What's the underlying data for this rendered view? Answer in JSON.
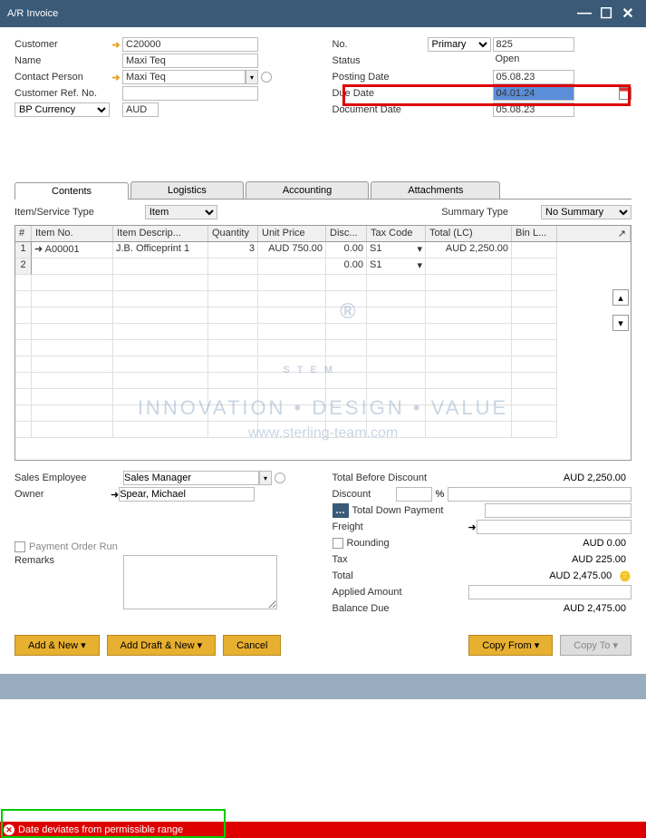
{
  "window": {
    "title": "A/R Invoice"
  },
  "header": {
    "left": {
      "customer_lbl": "Customer",
      "customer": "C20000",
      "name_lbl": "Name",
      "name": "Maxi Teq",
      "contact_lbl": "Contact Person",
      "contact": "Maxi Teq",
      "custref_lbl": "Customer Ref. No.",
      "custref": "",
      "bpcur_lbl": "BP Currency",
      "bpcur": "AUD"
    },
    "right": {
      "no_lbl": "No.",
      "no_type": "Primary",
      "no_val": "825",
      "status_lbl": "Status",
      "status": "Open",
      "posting_lbl": "Posting Date",
      "posting": "05.08.23",
      "due_lbl": "Due Date",
      "due": "04.01.24",
      "doc_lbl": "Document Date",
      "doc": "05.08.23"
    }
  },
  "tabs": [
    "Contents",
    "Logistics",
    "Accounting",
    "Attachments"
  ],
  "sub": {
    "itemservice_lbl": "Item/Service Type",
    "itemservice": "Item",
    "summary_lbl": "Summary Type",
    "summary": "No Summary"
  },
  "grid": {
    "columns": [
      "#",
      "Item No.",
      "Item Descrip...",
      "Quantity",
      "Unit Price",
      "Disc...",
      "Tax Code",
      "Total (LC)",
      "Bin L..."
    ],
    "rows": [
      {
        "n": "1",
        "item": "A00001",
        "desc": "J.B. Officeprint 1",
        "qty": "3",
        "price": "AUD 750.00",
        "disc": "0.00",
        "tax": "S1",
        "total": "AUD 2,250.00",
        "bin": ""
      },
      {
        "n": "2",
        "item": "",
        "desc": "",
        "qty": "",
        "price": "",
        "disc": "0.00",
        "tax": "S1",
        "total": "",
        "bin": ""
      }
    ]
  },
  "watermark": {
    "big": "STEM",
    "reg": "®",
    "tag": "INNOVATION  •  DESIGN  •  VALUE",
    "url": "www.sterling-team.com"
  },
  "bottom_left": {
    "sales_lbl": "Sales Employee",
    "sales": "Sales Manager",
    "owner_lbl": "Owner",
    "owner": "Spear, Michael",
    "payorder_lbl": "Payment Order Run",
    "remarks_lbl": "Remarks"
  },
  "bottom_right": {
    "tbd_lbl": "Total Before Discount",
    "tbd": "AUD 2,250.00",
    "disc_lbl": "Discount",
    "disc_pct": "",
    "pct": "%",
    "tdp_lbl": "Total Down Payment",
    "freight_lbl": "Freight",
    "round_lbl": "Rounding",
    "round": "AUD 0.00",
    "tax_lbl": "Tax",
    "tax": "AUD 225.00",
    "total_lbl": "Total",
    "total": "AUD 2,475.00",
    "applied_lbl": "Applied Amount",
    "balance_lbl": "Balance Due",
    "balance": "AUD 2,475.00"
  },
  "buttons": {
    "addnew": "Add & New",
    "adddraft": "Add Draft & New",
    "cancel": "Cancel",
    "copyfrom": "Copy From",
    "copyto": "Copy To"
  },
  "status": "Date deviates from permissible range"
}
